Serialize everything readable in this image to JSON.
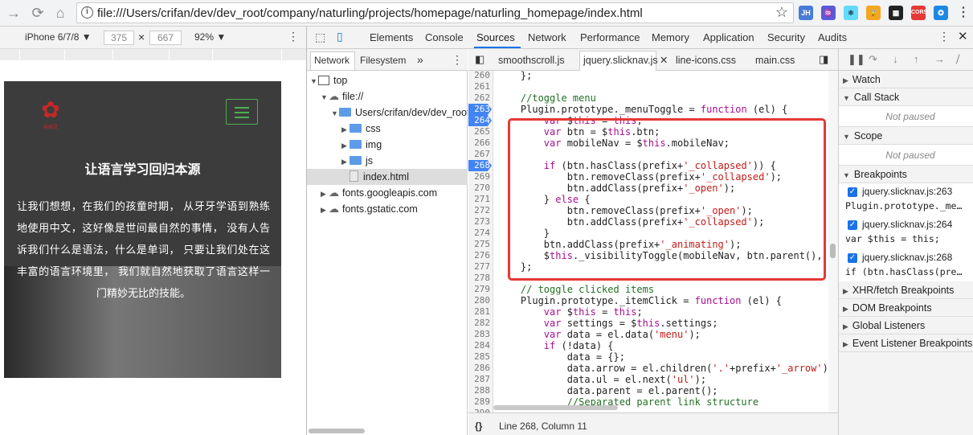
{
  "browser": {
    "url": "file:///Users/crifan/dev/dev_root/company/naturling/projects/homepage/naturling_homepage/index.html",
    "extensions": [
      "JH",
      "♒",
      "⚛",
      "🔒",
      "▦",
      "CORS",
      "✪",
      "⋮"
    ]
  },
  "device": {
    "name": "iPhone 6/7/8 ▼",
    "width": "375",
    "times": "×",
    "height": "667",
    "zoom": "92% ▼"
  },
  "phone": {
    "logo_sub": "纳德灵",
    "title": "让语言学习回归本源",
    "text": "让我们想想，在我们的孩童时期， 从牙牙学语到熟练地使用中文，这好像是世间最自然的事情， 没有人告诉我们什么是语法，什么是单词， 只要让我们处在这丰富的语言环境里， 我们就自然地获取了语言这样一门精妙无比的技能。"
  },
  "devtools": {
    "tabs": [
      "Elements",
      "Console",
      "Sources",
      "Network",
      "Performance",
      "Memory",
      "Application",
      "Security",
      "Audits"
    ]
  },
  "navigator": {
    "tabs": [
      "Network",
      "Filesystem",
      "»"
    ],
    "tree": [
      {
        "label": "top",
        "type": "frame",
        "indent": 0
      },
      {
        "label": "file://",
        "type": "cloud",
        "indent": 1
      },
      {
        "label": "Users/crifan/dev/dev_root",
        "type": "folder",
        "indent": 2,
        "open": true
      },
      {
        "label": "css",
        "type": "folder",
        "indent": 3
      },
      {
        "label": "img",
        "type": "folder",
        "indent": 3
      },
      {
        "label": "js",
        "type": "folder",
        "indent": 3
      },
      {
        "label": "index.html",
        "type": "file",
        "indent": 3
      },
      {
        "label": "fonts.googleapis.com",
        "type": "cloud",
        "indent": 1
      },
      {
        "label": "fonts.gstatic.com",
        "type": "cloud",
        "indent": 1
      }
    ]
  },
  "editor": {
    "tabs": [
      "smoothscroll.js",
      "jquery.slicknav.js",
      "line-icons.css",
      "main.css"
    ],
    "status": "Line 268, Column 11",
    "lines": [
      {
        "n": "260",
        "t": "    };"
      },
      {
        "n": "261",
        "t": ""
      },
      {
        "n": "262",
        "t": "    //toggle menu"
      },
      {
        "n": "263",
        "t": "    Plugin.prototype._menuToggle = function (el) {",
        "bp": true
      },
      {
        "n": "264",
        "t": "        var $this = this;",
        "bp": true
      },
      {
        "n": "265",
        "t": "        var btn = $this.btn;"
      },
      {
        "n": "266",
        "t": "        var mobileNav = $this.mobileNav;"
      },
      {
        "n": "267",
        "t": ""
      },
      {
        "n": "268",
        "t": "        if (btn.hasClass(prefix+'_collapsed')) {",
        "bp": true
      },
      {
        "n": "269",
        "t": "            btn.removeClass(prefix+'_collapsed');"
      },
      {
        "n": "270",
        "t": "            btn.addClass(prefix+'_open');"
      },
      {
        "n": "271",
        "t": "        } else {"
      },
      {
        "n": "272",
        "t": "            btn.removeClass(prefix+'_open');"
      },
      {
        "n": "273",
        "t": "            btn.addClass(prefix+'_collapsed');"
      },
      {
        "n": "274",
        "t": "        }"
      },
      {
        "n": "275",
        "t": "        btn.addClass(prefix+'_animating');"
      },
      {
        "n": "276",
        "t": "        $this._visibilityToggle(mobileNav, btn.parent(),"
      },
      {
        "n": "277",
        "t": "    };"
      },
      {
        "n": "278",
        "t": ""
      },
      {
        "n": "279",
        "t": "    // toggle clicked items"
      },
      {
        "n": "280",
        "t": "    Plugin.prototype._itemClick = function (el) {"
      },
      {
        "n": "281",
        "t": "        var $this = this;"
      },
      {
        "n": "282",
        "t": "        var settings = $this.settings;"
      },
      {
        "n": "283",
        "t": "        var data = el.data('menu');"
      },
      {
        "n": "284",
        "t": "        if (!data) {"
      },
      {
        "n": "285",
        "t": "            data = {};"
      },
      {
        "n": "286",
        "t": "            data.arrow = el.children('.'+prefix+'_arrow')"
      },
      {
        "n": "287",
        "t": "            data.ul = el.next('ul');"
      },
      {
        "n": "288",
        "t": "            data.parent = el.parent();"
      },
      {
        "n": "289",
        "t": "            //Separated parent link structure"
      },
      {
        "n": "290",
        "t": ""
      }
    ]
  },
  "debugger": {
    "sections": {
      "watch": "Watch",
      "callstack": "Call Stack",
      "callstack_state": "Not paused",
      "scope": "Scope",
      "scope_state": "Not paused",
      "breakpoints": "Breakpoints",
      "xhr": "XHR/fetch Breakpoints",
      "dom": "DOM Breakpoints",
      "global": "Global Listeners",
      "event": "Event Listener Breakpoints"
    },
    "breakpoints": [
      {
        "file": "jquery.slicknav.js:263",
        "code": "Plugin.prototype._me…"
      },
      {
        "file": "jquery.slicknav.js:264",
        "code": "var $this = this;"
      },
      {
        "file": "jquery.slicknav.js:268",
        "code": "if (btn.hasClass(pre…"
      }
    ]
  }
}
